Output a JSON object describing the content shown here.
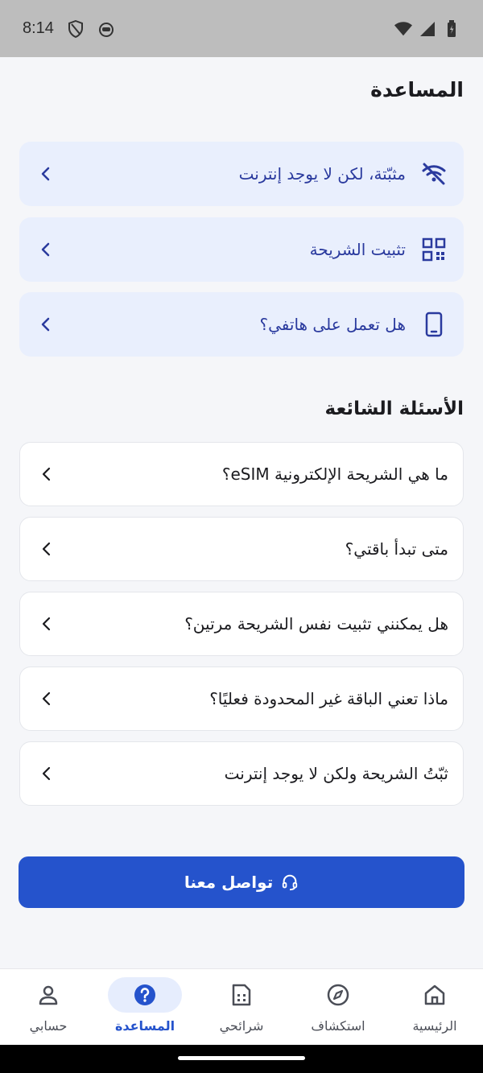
{
  "status_bar": {
    "time": "8:14"
  },
  "page": {
    "title": "المساعدة"
  },
  "quick_actions": [
    {
      "label": "مثبّتة، لكن لا يوجد إنترنت",
      "icon": "wifi-off-icon"
    },
    {
      "label": "تثبيت الشريحة",
      "icon": "qr-code-icon"
    },
    {
      "label": "هل تعمل على هاتفي؟",
      "icon": "phone-icon"
    }
  ],
  "faq": {
    "title": "الأسئلة الشائعة",
    "items": [
      {
        "question": "ما هي الشريحة الإلكترونية eSIM؟"
      },
      {
        "question": "متى تبدأ باقتي؟"
      },
      {
        "question": "هل يمكنني تثبيت نفس الشريحة مرتين؟"
      },
      {
        "question": "ماذا تعني الباقة غير المحدودة فعليًا؟"
      },
      {
        "question": "ثبّتُ الشريحة ولكن لا يوجد إنترنت"
      }
    ]
  },
  "contact": {
    "label": "تواصل معنا",
    "icon": "headset-icon"
  },
  "bottom_nav": {
    "items": [
      {
        "label": "حسابي",
        "icon": "user-icon",
        "active": false
      },
      {
        "label": "المساعدة",
        "icon": "help-icon",
        "active": true
      },
      {
        "label": "شرائحي",
        "icon": "sim-card-icon",
        "active": false
      },
      {
        "label": "استكشاف",
        "icon": "compass-icon",
        "active": false
      },
      {
        "label": "الرئيسية",
        "icon": "home-icon",
        "active": false
      }
    ]
  },
  "colors": {
    "accent": "#2553cc",
    "quick_bg": "#e9effd",
    "quick_text": "#2a3a9e",
    "page_bg": "#f5f6f9"
  }
}
